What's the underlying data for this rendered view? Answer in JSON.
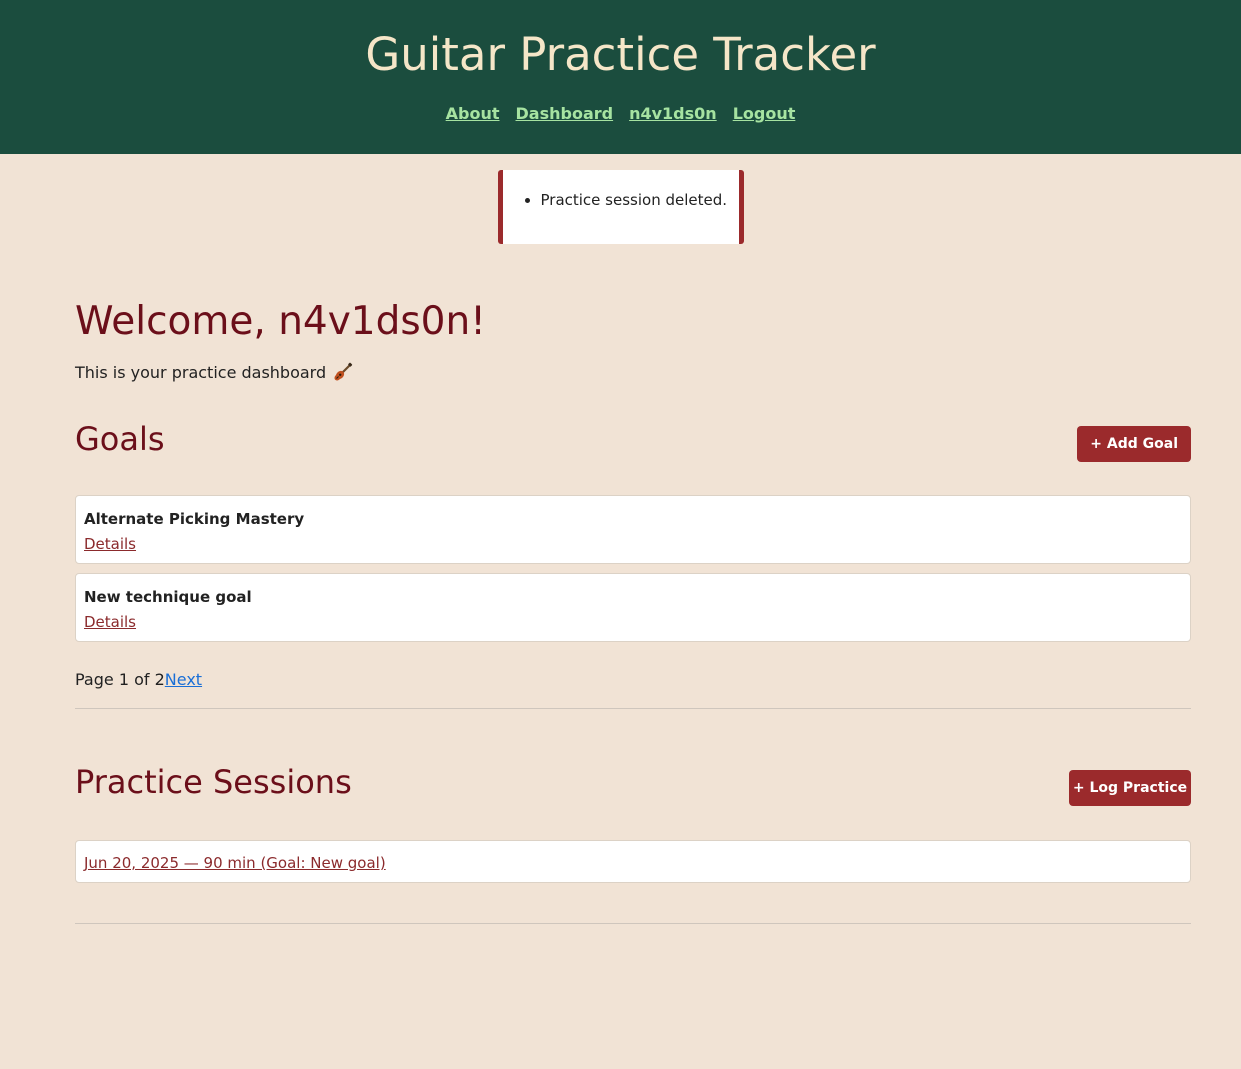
{
  "header": {
    "title": "Guitar Practice Tracker",
    "nav": [
      {
        "label": "About"
      },
      {
        "label": "Dashboard"
      },
      {
        "label": "n4v1ds0n"
      },
      {
        "label": "Logout"
      }
    ]
  },
  "flash": {
    "messages": [
      "Practice session deleted."
    ]
  },
  "welcome": {
    "heading": "Welcome, n4v1ds0n!",
    "subtitle": "This is your practice dashboard",
    "subtitle_icon": "guitar-icon"
  },
  "goals": {
    "title": "Goals",
    "add_button": "+ Add Goal",
    "items": [
      {
        "name": "Alternate Picking Mastery",
        "details_label": "Details"
      },
      {
        "name": "New technique goal",
        "details_label": "Details"
      }
    ],
    "pagination": {
      "text": "Page 1 of 2",
      "next_label": "Next"
    }
  },
  "sessions": {
    "title": "Practice Sessions",
    "log_button": "+ Log Practice",
    "items": [
      {
        "label": "Jun 20, 2025 — 90 min (Goal: New goal)"
      }
    ]
  },
  "colors": {
    "header_bg": "#1b4d3e",
    "title": "#f5e6c8",
    "nav_link": "#a6e3a1",
    "page_bg": "#f1e3d5",
    "accent": "#9b2a2c",
    "heading": "#6b0f1a",
    "pagination_link": "#1a6fd6"
  }
}
